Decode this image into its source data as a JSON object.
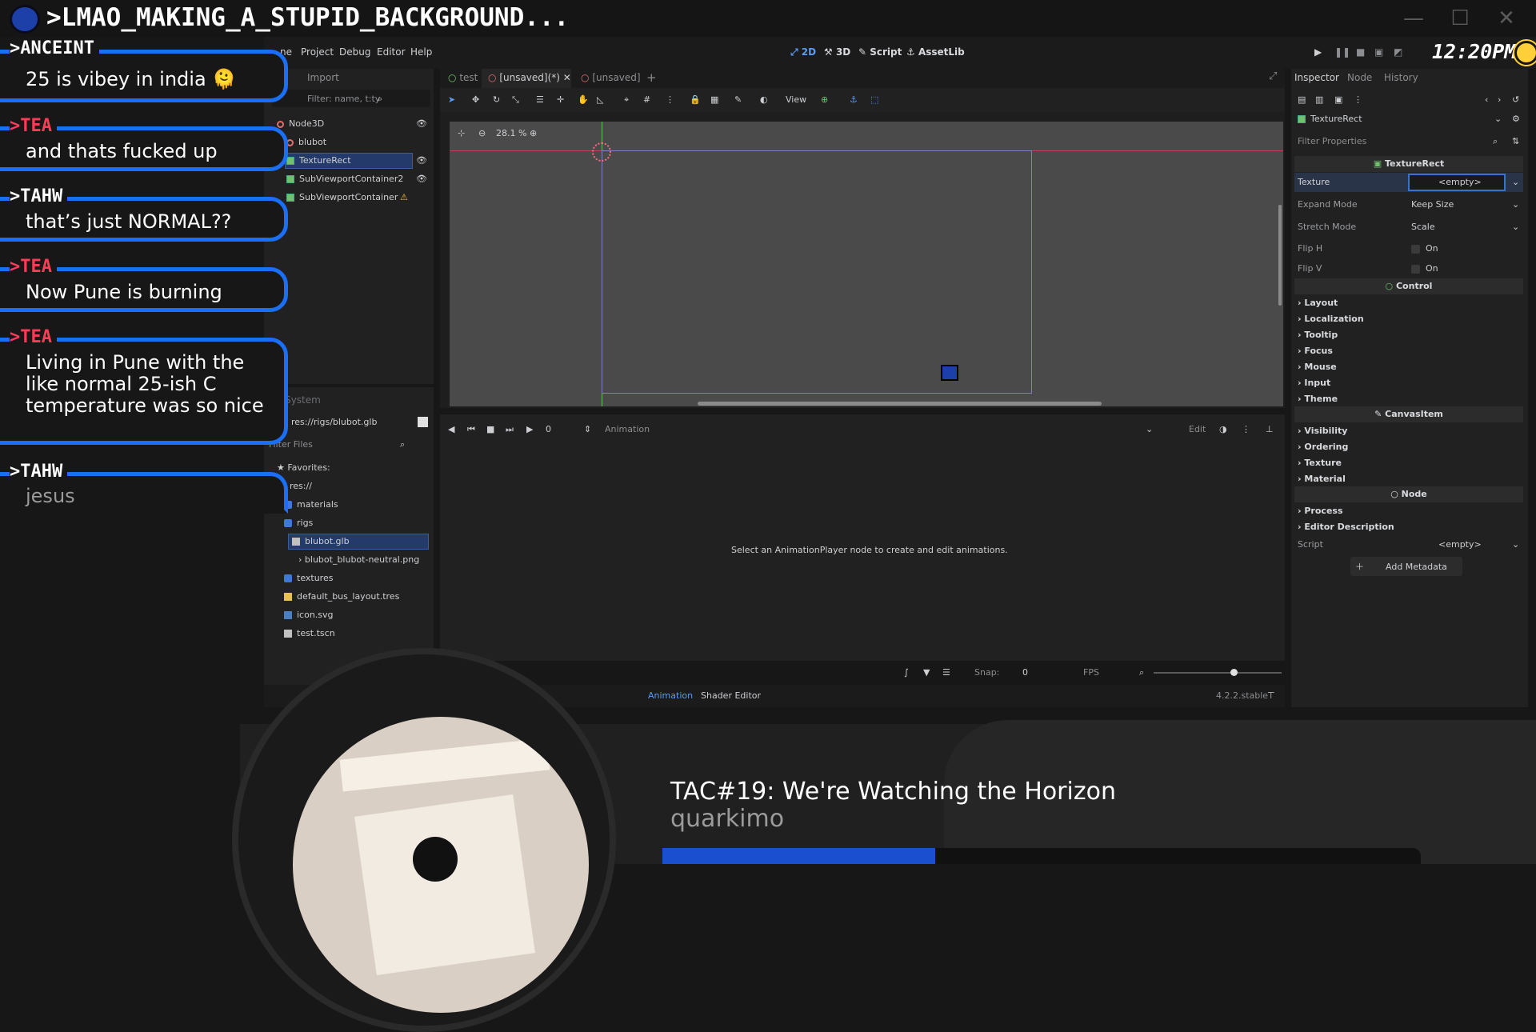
{
  "stream": {
    "title": ">LMAO_MAKING_A_STUPID_BACKGROUND...",
    "clock": "12:20PM"
  },
  "menu": {
    "items": [
      "ne",
      "Project",
      "Debug",
      "Editor",
      "Help"
    ]
  },
  "workspace": {
    "btn_2d": "2D",
    "btn_3d": "3D",
    "btn_script": "Script",
    "btn_assetlib": "AssetLib"
  },
  "scene_dock": {
    "tab_import": "Import",
    "filter_placeholder": "Filter: name, t:ty",
    "nodes": [
      "Node3D",
      "blubot",
      "TextureRect",
      "SubViewportContainer2",
      "SubViewportContainer"
    ]
  },
  "filesystem": {
    "tab": "FileSystem",
    "path": "res://rigs/blubot.glb",
    "filter_placeholder": "Filter Files",
    "favorites": "Favorites:",
    "items": [
      "res://",
      "materials",
      "rigs",
      "blubot.glb",
      "blubot_blubot-neutral.png",
      "textures",
      "default_bus_layout.tres",
      "icon.svg",
      "test.tscn"
    ]
  },
  "editor_tabs": [
    "test",
    "[unsaved](*)",
    "[unsaved]"
  ],
  "viewport": {
    "zoom": "28.1 %",
    "view_menu": "View"
  },
  "animation": {
    "frame": "0",
    "name_placeholder": "Animation",
    "edit": "Edit",
    "message": "Select an AnimationPlayer node to create and edit animations.",
    "snap_label": "Snap:",
    "snap_value": "0",
    "fps": "FPS"
  },
  "bottom_tabs": {
    "animation": "Animation",
    "shader": "Shader Editor",
    "version": "4.2.2.stable"
  },
  "inspector": {
    "tabs": [
      "Inspector",
      "Node",
      "History"
    ],
    "object": "TextureRect",
    "filter_placeholder": "Filter Properties",
    "section_texturerect": "TextureRect",
    "props": [
      {
        "label": "Texture",
        "value": "<empty>"
      },
      {
        "label": "Expand Mode",
        "value": "Keep Size"
      },
      {
        "label": "Stretch Mode",
        "value": "Scale"
      },
      {
        "label": "Flip H",
        "value": "On"
      },
      {
        "label": "Flip V",
        "value": "On"
      }
    ],
    "section_control": "Control",
    "control_groups": [
      "Layout",
      "Localization",
      "Tooltip",
      "Focus",
      "Mouse",
      "Input",
      "Theme"
    ],
    "section_canvas": "CanvasItem",
    "canvas_groups": [
      "Visibility",
      "Ordering",
      "Texture",
      "Material"
    ],
    "section_node": "Node",
    "node_groups": [
      "Process",
      "Editor Description"
    ],
    "script_label": "Script",
    "script_value": "<empty>",
    "add_metadata": "Add Metadata"
  },
  "chat": [
    {
      "name": ">ANCEINT",
      "text": "25 is vibey in india 🫠",
      "color": "#ffffff"
    },
    {
      "name": ">TEA",
      "text": "and thats fucked up",
      "color": "#ff3b57"
    },
    {
      "name": ">TAHW",
      "text": "that’s just NORMAL??",
      "color": "#ffffff"
    },
    {
      "name": ">TEA",
      "text": "Now Pune is burning",
      "color": "#ff3b57"
    },
    {
      "name": ">TEA",
      "text": "Living in Pune with the like normal 25-ish C temperature was so nice",
      "color": "#ff3b57"
    },
    {
      "name": ">TAHW",
      "text": "jesus",
      "color": "#ffffff"
    }
  ],
  "now_playing": {
    "title": "TAC#19: We're Watching the Horizon",
    "artist": "quarkimo",
    "progress": 0.36
  },
  "colors": {
    "accent": "#1a6ff4",
    "progress": "#1a50cf",
    "selection": "#233a6b"
  }
}
